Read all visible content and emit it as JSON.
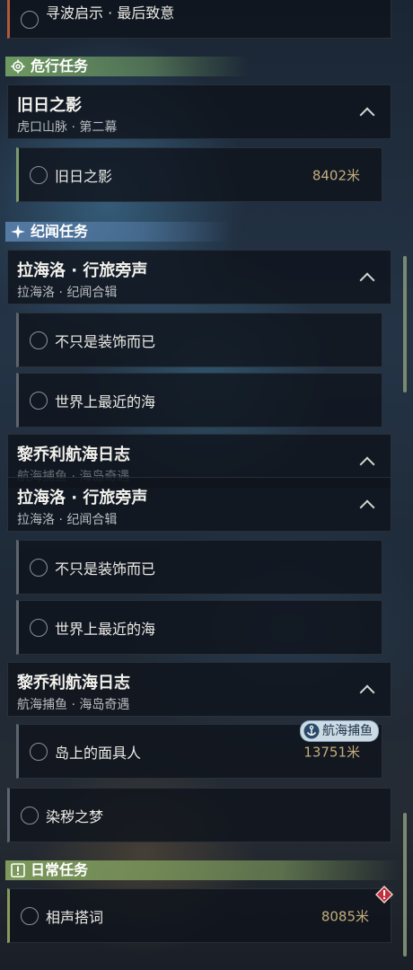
{
  "colors": {
    "distance_gold": "#c2ad7c",
    "section_green": "#73a064",
    "section_blue": "#5a82af",
    "warning_red": "#c0303c",
    "badge_blue": "#2a4a6a"
  },
  "top_partial_quest": {
    "name": "寻波启示 · 最后致意"
  },
  "sections": {
    "danger": {
      "label": "危行任务",
      "icon": "gear-icon"
    },
    "chronicle": {
      "label": "纪闻任务",
      "icon": "sparkle-icon"
    },
    "daily": {
      "label": "日常任务",
      "icon": "exclamation-box-icon"
    }
  },
  "groups": {
    "old_days": {
      "title": "旧日之影",
      "subtitle": "虎口山脉 · 第二幕"
    },
    "lahailuo_1": {
      "title": "拉海洛 · 行旅旁声",
      "subtitle": "拉海洛 · 纪闻合辑"
    },
    "liqiaoli_1": {
      "title": "黎乔利航海日志",
      "subtitle": "航海捕鱼 · 海岛奇遇"
    },
    "lahailuo_2": {
      "title": "拉海洛 · 行旅旁声",
      "subtitle": "拉海洛 · 纪闻合辑"
    },
    "liqiaoli_2": {
      "title": "黎乔利航海日志",
      "subtitle": "航海捕鱼 · 海岛奇遇"
    }
  },
  "quests": {
    "old_days_q": {
      "name": "旧日之影",
      "distance": "8402米"
    },
    "not_decor_1": {
      "name": "不只是装饰而已"
    },
    "nearest_sea_1": {
      "name": "世界上最近的海"
    },
    "not_decor_2": {
      "name": "不只是装饰而已"
    },
    "nearest_sea_2": {
      "name": "世界上最近的海"
    },
    "island_mask": {
      "name": "岛上的面具人",
      "distance": "13751米",
      "badge": "航海捕鱼"
    },
    "dye_dream": {
      "name": "染秽之梦"
    },
    "crosstalk": {
      "name": "相声搭词",
      "distance": "8085米"
    }
  }
}
